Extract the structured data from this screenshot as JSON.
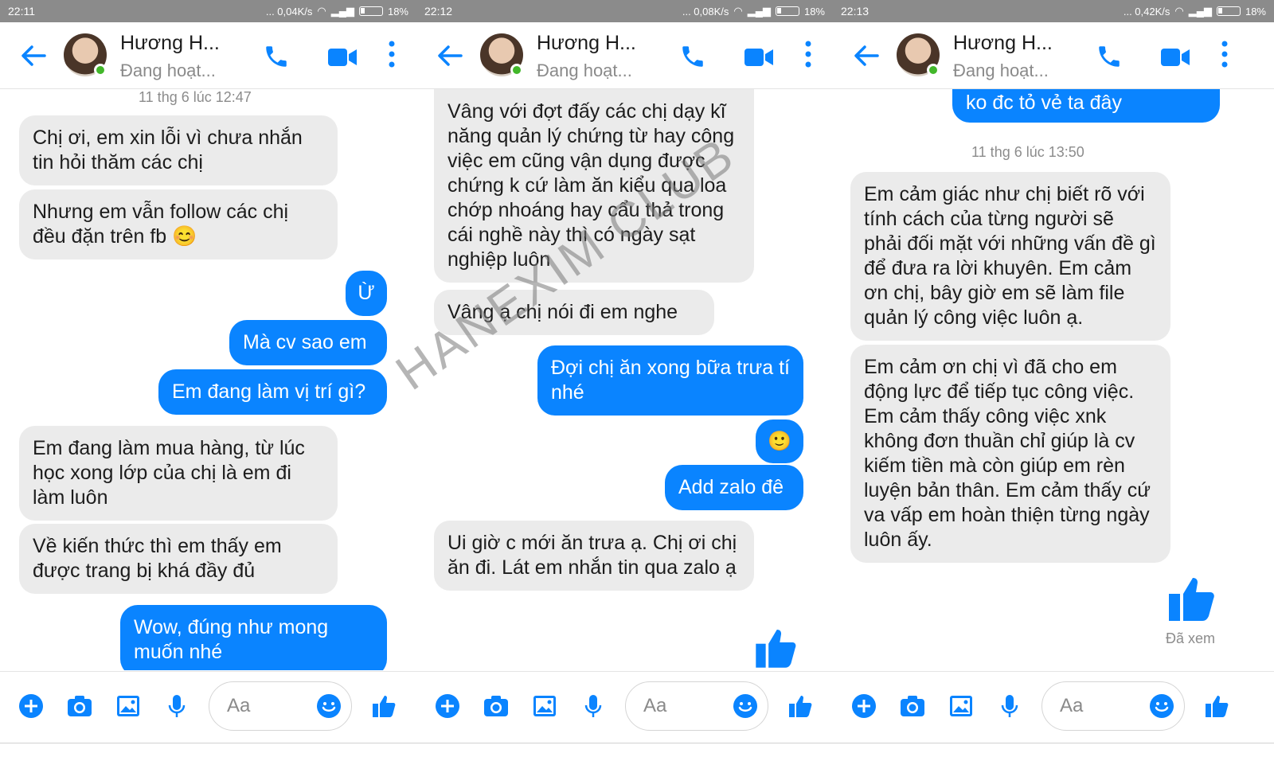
{
  "panels": [
    {
      "status": {
        "time": "22:11",
        "speed": "... 0,04K/s",
        "battery": "18%"
      },
      "contact": {
        "name": "Hương H...",
        "status": "Đang hoạt..."
      },
      "timestamp": "11 thg 6 lúc 12:47",
      "messages": [
        {
          "from": "in",
          "text": "Chị ơi, em xin lỗi vì chưa nhắn tin hỏi thăm các chị"
        },
        {
          "from": "in",
          "text": "Nhưng em vẫn follow các chị đều đặn trên fb 😊"
        },
        {
          "from": "out",
          "text": "Ừ"
        },
        {
          "from": "out",
          "text": "Mà cv sao em"
        },
        {
          "from": "out",
          "text": "Em đang làm vị trí gì?"
        },
        {
          "from": "in",
          "text": "Em đang làm mua hàng, từ lúc học xong lớp của chị là em đi làm luôn"
        },
        {
          "from": "in",
          "text": "Về kiến thức thì em thấy em được trang bị khá đầy đủ"
        },
        {
          "from": "out",
          "text": "Wow, đúng như mong muốn nhé"
        }
      ],
      "input_placeholder": "Aa"
    },
    {
      "status": {
        "time": "22:12",
        "speed": "... 0,08K/s",
        "battery": "18%"
      },
      "contact": {
        "name": "Hương H...",
        "status": "Đang hoạt..."
      },
      "messages": [
        {
          "from": "in",
          "text": "Vâng với đợt đấy các chị dạy kĩ năng quản lý chứng từ hay công việc em cũng vận dụng được chứng k cứ làm ăn kiểu qua loa chớp nhoáng hay cẩu thả trong cái nghề này thì có ngày sạt nghiệp luôn"
        },
        {
          "from": "in",
          "text": "Vâng ạ chị nói đi em nghe"
        },
        {
          "from": "out",
          "text": "Đợi chị ăn xong bữa trưa tí nhé"
        },
        {
          "from": "out",
          "text": "🙂"
        },
        {
          "from": "out",
          "text": "Add zalo đê"
        },
        {
          "from": "in",
          "text": "Ui giờ c mới ăn trưa ạ. Chị ơi chị ăn đi. Lát em nhắn tin qua zalo ạ"
        }
      ],
      "input_placeholder": "Aa"
    },
    {
      "status": {
        "time": "22:13",
        "speed": "... 0,42K/s",
        "battery": "18%"
      },
      "contact": {
        "name": "Hương H...",
        "status": "Đang hoạt..."
      },
      "timestamp": "11 thg 6 lúc 13:50",
      "messages": [
        {
          "from": "out",
          "text": "ko đc tỏ vẻ ta đây"
        },
        {
          "from": "in",
          "text": "Em cảm giác như chị biết rõ với tính cách của từng người sẽ phải đối mặt với những vấn đề gì để đưa ra lời khuyên. Em cảm ơn chị, bây giờ em sẽ làm file quản lý công việc luôn ạ."
        },
        {
          "from": "in",
          "text": "Em cảm ơn chị vì đã cho em động lực để tiếp tục công việc. Em cảm thấy công việc xnk không đơn thuần chỉ giúp là cv kiếm tiền mà còn giúp em rèn luyện bản thân. Em cảm thấy cứ va vấp em hoàn thiện từng ngày luôn ấy."
        }
      ],
      "seen_label": "Đã xem",
      "input_placeholder": "Aa"
    }
  ],
  "watermark": "HANEXIM CLUB",
  "colors": {
    "accent": "#0a84ff",
    "incoming": "#ebebeb",
    "statusbar": "#8b8b8b"
  }
}
